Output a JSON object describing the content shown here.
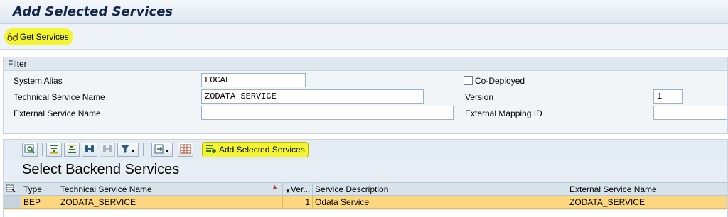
{
  "page": {
    "title": "Add Selected Services"
  },
  "toolbar": {
    "get_services_label": "Get Services",
    "get_services_icon": "glasses-icon"
  },
  "filter": {
    "legend": "Filter",
    "system_alias_label": "System Alias",
    "system_alias_value": "LOCAL",
    "technical_service_name_label": "Technical Service Name",
    "technical_service_name_value": "ZODATA_SERVICE",
    "external_service_name_label": "External Service Name",
    "external_service_name_value": "",
    "co_deployed_label": "Co-Deployed",
    "co_deployed_checked": false,
    "version_label": "Version",
    "version_value": "1",
    "external_mapping_id_label": "External Mapping ID",
    "external_mapping_id_value": ""
  },
  "grid_toolbar": {
    "add_selected_label": "Add Selected Services",
    "buttons": [
      "details-icon",
      "sort-ascending-icon",
      "sort-descending-icon",
      "find-icon",
      "find-next-icon",
      "filter-icon",
      "export-icon",
      "layout-icon"
    ]
  },
  "grid": {
    "title": "Select Backend Services",
    "columns": {
      "type": "Type",
      "technical_service_name": "Technical Service Name",
      "version": "Ver...",
      "service_description": "Service Description",
      "external_service_name": "External Service Name"
    },
    "rows": [
      {
        "type": "BEP",
        "technical_service_name": "ZODATA_SERVICE",
        "version": "1",
        "service_description": "Odata Service",
        "external_service_name": "ZODATA_SERVICE"
      }
    ]
  },
  "colors": {
    "highlight": "#f3f532",
    "selected_row": "#fdd77f",
    "title_text": "#12264a"
  }
}
